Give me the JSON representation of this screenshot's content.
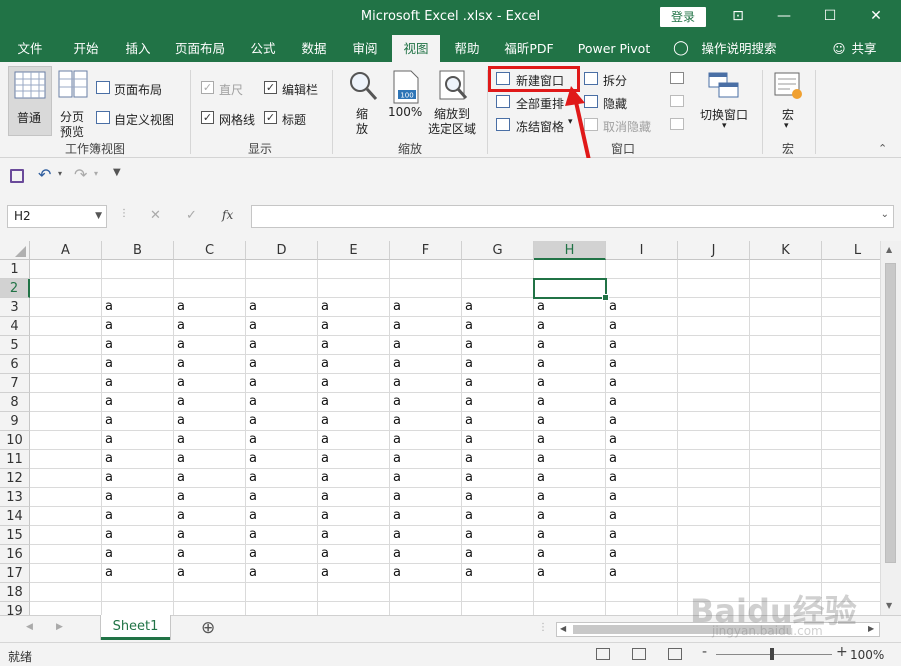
{
  "window": {
    "title": "Microsoft Excel .xlsx  -  Excel",
    "login_label": "登录",
    "controls": {
      "ribbon_options": "⊡",
      "minimize": "—",
      "maximize": "☐",
      "close": "✕"
    }
  },
  "tabs": [
    "文件",
    "开始",
    "插入",
    "页面布局",
    "公式",
    "数据",
    "审阅",
    "视图",
    "帮助",
    "福昕PDF",
    "Power Pivot",
    "操作说明搜索",
    "共享"
  ],
  "active_tab": "视图",
  "ribbon": {
    "workbook_views": {
      "normal": "普通",
      "page_break_line1": "分页",
      "page_break_line2": "预览",
      "page_layout": "页面布局",
      "custom_views": "自定义视图",
      "label": "工作簿视图"
    },
    "show": {
      "ruler": "直尺",
      "formula_bar": "编辑栏",
      "gridlines": "网格线",
      "headings": "标题",
      "label": "显示",
      "checks": {
        "ruler": "✓",
        "formula_bar": "✓",
        "gridlines": "✓",
        "headings": "✓"
      }
    },
    "zoom": {
      "zoom_line1": "缩",
      "zoom_line2": "放",
      "zoom100": "100%",
      "icon_100": "100",
      "zoom_sel_line1": "缩放到",
      "zoom_sel_line2": "选定区域",
      "label": "缩放"
    },
    "window": {
      "new_window": "新建窗口",
      "arrange_all": "全部重排",
      "freeze_panes": "冻结窗格",
      "split": "拆分",
      "hide": "隐藏",
      "unhide": "取消隐藏",
      "switch_windows": "切换窗口",
      "label": "窗口"
    },
    "macros": {
      "macros": "宏",
      "label": "宏"
    }
  },
  "formula_bar": {
    "name_box": "H2",
    "fx": "fx",
    "cancel": "✕",
    "enter": "✓",
    "value": ""
  },
  "grid": {
    "columns": [
      "A",
      "B",
      "C",
      "D",
      "E",
      "F",
      "G",
      "H",
      "I",
      "J",
      "K",
      "L"
    ],
    "rows": [
      "1",
      "2",
      "3",
      "4",
      "5",
      "6",
      "7",
      "8",
      "9",
      "10",
      "11",
      "12",
      "13",
      "14",
      "15",
      "16",
      "17",
      "18",
      "19"
    ],
    "selected_cell": "H2",
    "filled_value": "a",
    "filled_rows": [
      "3",
      "4",
      "5",
      "6",
      "7",
      "8",
      "9",
      "10",
      "11",
      "12",
      "13",
      "14",
      "15",
      "16",
      "17"
    ],
    "filled_cols": [
      "B",
      "C",
      "D",
      "E",
      "F",
      "G",
      "H",
      "I"
    ]
  },
  "sheets": [
    "Sheet1"
  ],
  "add_sheet": "⊕",
  "status": {
    "ready": "就绪",
    "zoom": "100%",
    "zoom_minus": "-",
    "zoom_plus": "+"
  },
  "watermark": {
    "brand": "Baidu经验",
    "url": "jingyan.baidu.com"
  },
  "colors": {
    "accent": "#217346",
    "highlight": "#e01919"
  }
}
